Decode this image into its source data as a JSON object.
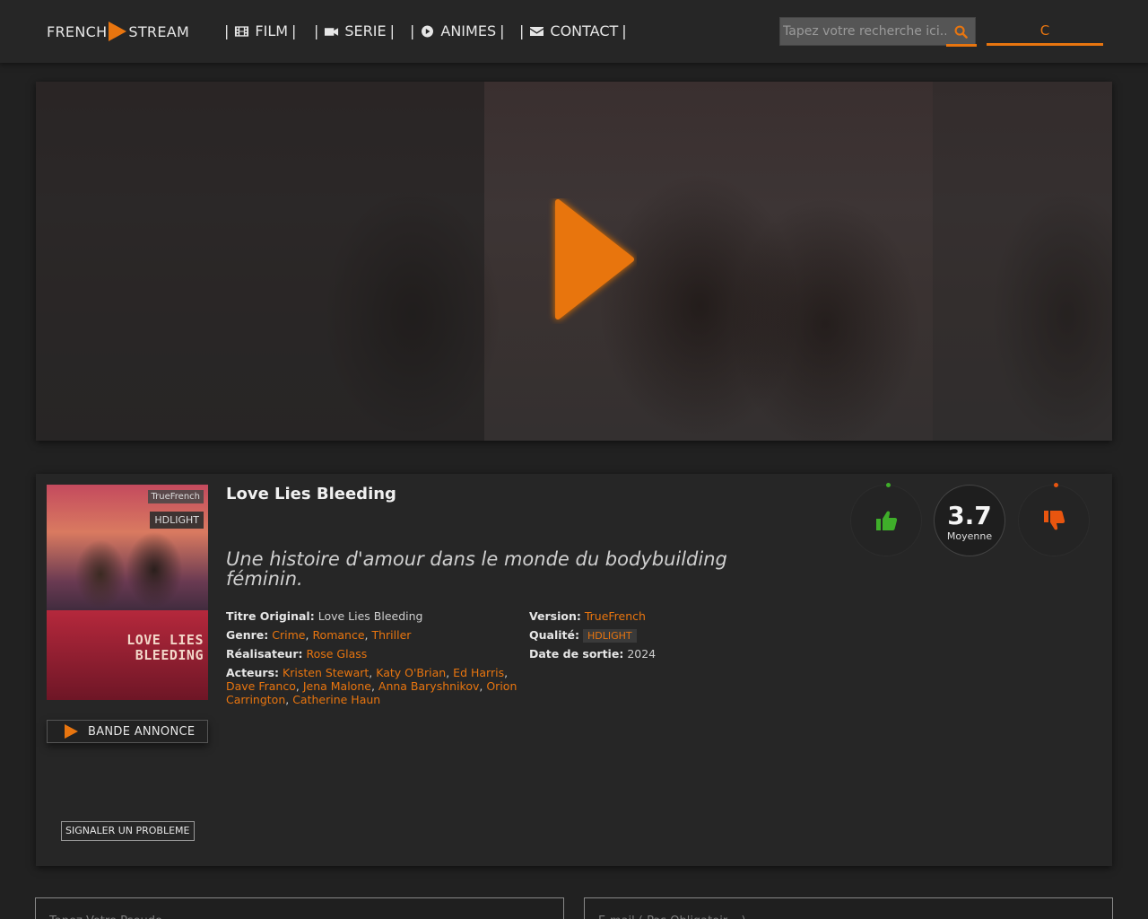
{
  "header": {
    "logo_left": "FRENCH",
    "logo_right": "STREAM",
    "nav": [
      {
        "label": "FILM",
        "icon": "film-icon"
      },
      {
        "label": "SERIE",
        "icon": "video-camera-icon"
      },
      {
        "label": "ANIMES",
        "icon": "play-circle-icon"
      },
      {
        "label": "CONTACT",
        "icon": "envelope-icon"
      }
    ],
    "search_placeholder": "Tapez votre recherche ici...",
    "login_label": "C",
    "accent": "#e8750f"
  },
  "movie": {
    "title": "Love Lies Bleeding",
    "tagline": "Une histoire d'amour dans le monde du bodybuilding féminin.",
    "poster": {
      "badge_version": "TrueFrench",
      "badge_quality": "HDLIGHT",
      "title_art": "LOVE LIES BLEEDING"
    },
    "trailer_label": "BANDE ANNONCE",
    "report_label": "SIGNALER UN PROBLEME",
    "labels": {
      "original_title": "Titre Original:",
      "genre": "Genre:",
      "director": "Réalisateur:",
      "actors": "Acteurs:",
      "version": "Version:",
      "quality": "Qualité:",
      "release": "Date de sortie:"
    },
    "original_title": "Love Lies Bleeding",
    "genres": [
      "Crime",
      "Romance",
      "Thriller"
    ],
    "director": "Rose Glass",
    "actors": [
      "Kristen Stewart",
      "Katy O'Brian",
      "Ed Harris",
      "Dave Franco",
      "Jena Malone",
      "Anna Baryshnikov",
      "Orion Carrington",
      "Catherine Haun"
    ],
    "version": "TrueFrench",
    "quality": "HDLIGHT",
    "release_year": "2024"
  },
  "rating": {
    "score": "3.7",
    "score_label": "Moyenne",
    "like_color": "#3fae2a",
    "dislike_color": "#e8550f"
  },
  "comment_form": {
    "pseudo_placeholder": "Tapez Votre Pseudo",
    "email_placeholder": "E-mail ( Pas Obligatoir... )"
  }
}
